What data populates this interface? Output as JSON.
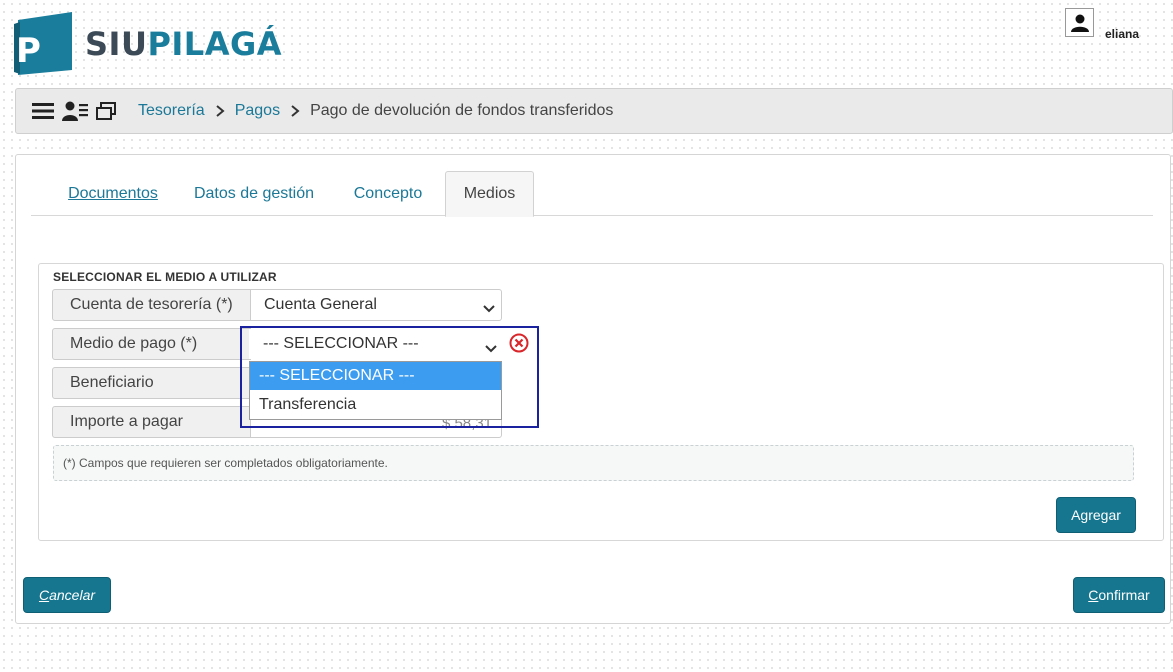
{
  "app": {
    "logo_text_a": "SIU",
    "logo_text_b": "PILAGÁ",
    "logo_letter": "P"
  },
  "user": {
    "name": "eliana"
  },
  "breadcrumb": {
    "items": [
      "Tesorería",
      "Pagos"
    ],
    "current": "Pago de devolución de fondos transferidos"
  },
  "tabs": [
    {
      "label": "Documentos",
      "active": false
    },
    {
      "label": "Datos de gestión",
      "active": false
    },
    {
      "label": "Concepto",
      "active": false
    },
    {
      "label": "Medios",
      "active": true
    }
  ],
  "section": {
    "title": "SELECCIONAR EL MEDIO A UTILIZAR",
    "fields": {
      "cuenta": {
        "label": "Cuenta de tesorería (*)",
        "value": "Cuenta General"
      },
      "medio": {
        "label": "Medio de pago (*)",
        "value": "--- SELECCIONAR ---"
      },
      "beneficiario": {
        "label": "Beneficiario",
        "value": ""
      },
      "importe": {
        "label": "Importe a pagar",
        "value": "$ 58,31"
      }
    },
    "note": "(*) Campos que requieren ser completados obligatoriamente."
  },
  "dropdown": {
    "options": [
      "--- SELECCIONAR ---",
      "Transferencia"
    ],
    "selected_index": 0
  },
  "buttons": {
    "agregar": "Agregar",
    "cancelar_first": "C",
    "cancelar_rest": "ancelar",
    "confirmar_first": "C",
    "confirmar_rest": "onfirmar"
  },
  "colors": {
    "accent": "#16768f",
    "link": "#1b7897",
    "highlight": "#3b9cf0",
    "focus_border": "#1a22a0",
    "error": "#d9262b"
  }
}
